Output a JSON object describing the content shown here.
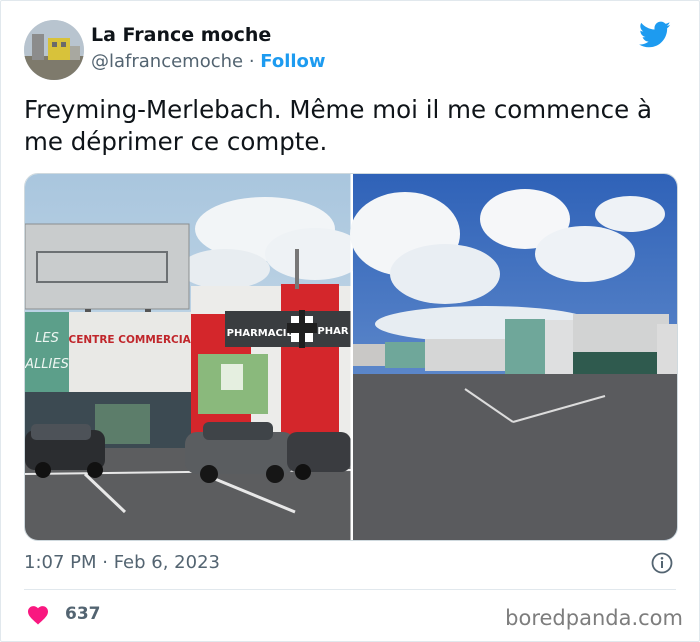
{
  "author": {
    "display_name": "La France moche",
    "handle": "@lafrancemoche",
    "separator": " · ",
    "follow_label": "Follow"
  },
  "tweet": {
    "text": "Freyming-Merlebach. Même moi il me commence à me déprimer ce compte.",
    "timestamp": "1:07 PM · Feb 6, 2023",
    "like_count": "637"
  },
  "media": {
    "left_photo": {
      "sign_left": "LES\nALLIES",
      "sign_centre": "CENTRE COMMERCIAL",
      "sign_pharmacie": "PHARMACIE",
      "sign_phar": "PHAR"
    }
  },
  "watermark": "boredpanda.com",
  "colors": {
    "accent": "#1d9bf0",
    "heart": "#f91880",
    "text_secondary": "#536471"
  },
  "icons": [
    "twitter-bird-icon",
    "info-icon",
    "heart-icon"
  ]
}
